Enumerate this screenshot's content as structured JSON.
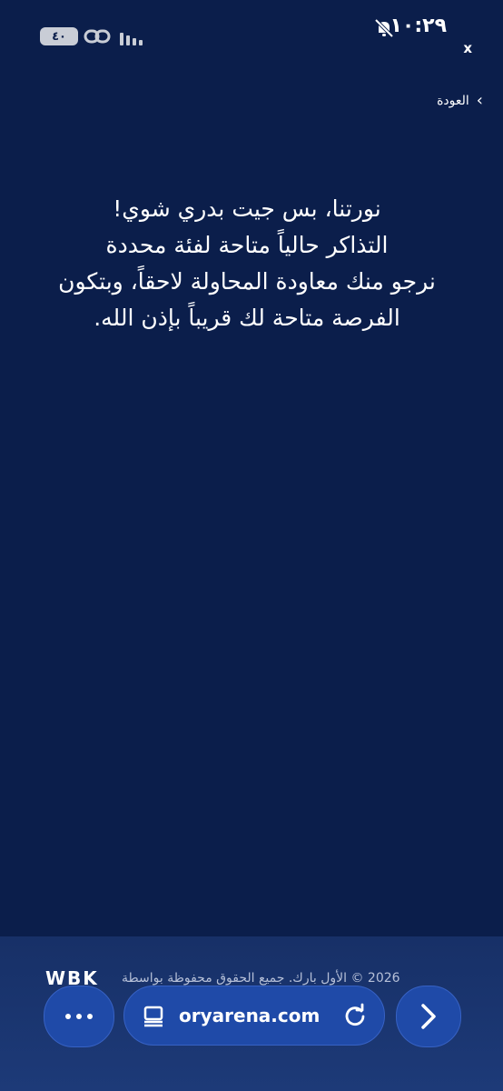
{
  "status_bar": {
    "battery": "٤٠",
    "time": "١٠:٢٩",
    "close": "x"
  },
  "nav": {
    "back_label": "العودة"
  },
  "message": {
    "line1": "نورتنا، بس جيت بدري شوي!",
    "line2": "التذاكر حالياً متاحة لفئة محددة",
    "line3": "نرجو منك معاودة المحاولة لاحقاً، وبتكون",
    "line4": "الفرصة متاحة لك قريباً بإذن الله."
  },
  "footer": {
    "brand": "WBK",
    "text": "2026 © الأول بارك. جميع الحقوق محفوظة بواسطة"
  },
  "browser": {
    "url": "oryarena.com"
  },
  "icons": {
    "mute": "bell-off-icon",
    "link": "link-icon",
    "signal": "signal-icon",
    "tabs": "tabs-icon",
    "reload": "reload-icon",
    "forward": "chevron-right-icon",
    "back": "chevron-left-icon",
    "menu": "more-icon"
  },
  "colors": {
    "background": "#0b1e4b",
    "footer": "#173067",
    "button": "#1f4aa8"
  }
}
